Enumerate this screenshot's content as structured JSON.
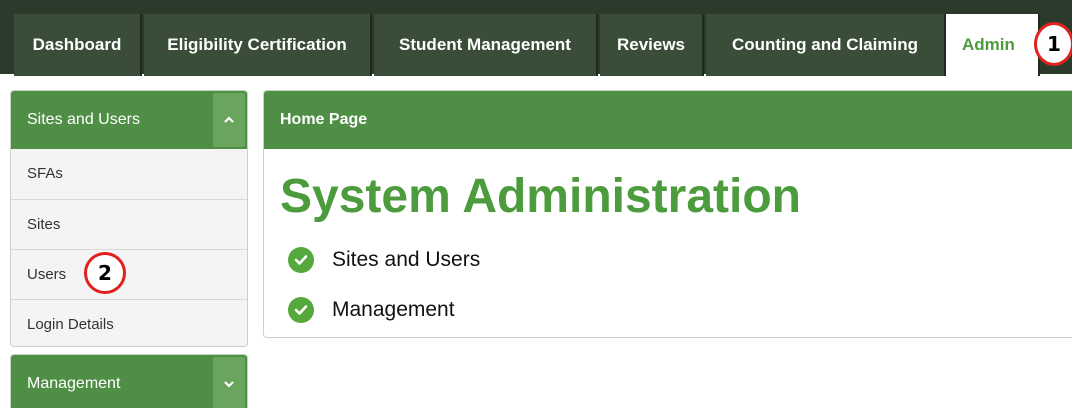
{
  "topnav": {
    "tabs": [
      {
        "label": "Dashboard"
      },
      {
        "label": "Eligibility Certification"
      },
      {
        "label": "Student Management"
      },
      {
        "label": "Reviews"
      },
      {
        "label": "Counting and Claiming"
      },
      {
        "label": "Admin"
      }
    ],
    "active_tab": "Admin"
  },
  "callouts": [
    "1",
    "2"
  ],
  "sidebar": {
    "sites_and_users": {
      "title": "Sites and Users",
      "toggle_icon": "chevron-up-icon",
      "items": [
        {
          "label": "SFAs"
        },
        {
          "label": "Sites"
        },
        {
          "label": "Users"
        },
        {
          "label": "Login Details"
        }
      ]
    },
    "management": {
      "title": "Management",
      "toggle_icon": "chevron-down-icon"
    }
  },
  "main": {
    "header": "Home Page",
    "title": "System Administration",
    "links": [
      {
        "label": "Sites and Users",
        "icon": "check-circle-icon"
      },
      {
        "label": "Management",
        "icon": "check-circle-icon"
      }
    ]
  },
  "colors": {
    "nav_bg": "#2b3a2b",
    "tab_bg": "#3a4d38",
    "accent_green": "#4c9b3c",
    "panel_header": "#4f8f45",
    "callout_red": "#e0211e"
  }
}
